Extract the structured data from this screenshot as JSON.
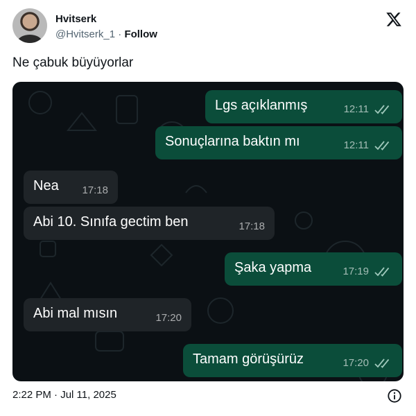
{
  "author": {
    "name": "Hvitserk",
    "handle": "@Hvitserk_1",
    "separator": " · ",
    "follow_label": "Follow"
  },
  "tweet": {
    "text": "Ne çabuk büyüyorlar",
    "timestamp": "2:22 PM · Jul 11, 2025"
  },
  "icons": {
    "platform_logo": "x-logo-icon",
    "info": "info-icon",
    "read_receipt": "double-check-icon"
  },
  "chat": {
    "messages": [
      {
        "direction": "outgoing",
        "text": "Lgs açıklanmış",
        "time": "12:11",
        "read": true
      },
      {
        "direction": "outgoing",
        "text": "Sonuçlarına baktın mı",
        "time": "12:11",
        "read": true
      },
      {
        "direction": "incoming",
        "text": "Nea",
        "time": "17:18"
      },
      {
        "direction": "incoming",
        "text": "Abi 10. Sınıfa gectim ben",
        "time": "17:18"
      },
      {
        "direction": "outgoing",
        "text": "Şaka yapma",
        "time": "17:19",
        "read": true
      },
      {
        "direction": "incoming",
        "text": "Abi mal mısın",
        "time": "17:20"
      },
      {
        "direction": "outgoing",
        "text": "Tamam görüşürüz",
        "time": "17:20",
        "read": true
      }
    ]
  },
  "colors": {
    "outgoing_bubble": "#0b4d3a",
    "incoming_bubble": "#1f2428",
    "chat_background": "#0b1014",
    "text_primary": "#0f1419",
    "text_secondary": "#536471"
  }
}
